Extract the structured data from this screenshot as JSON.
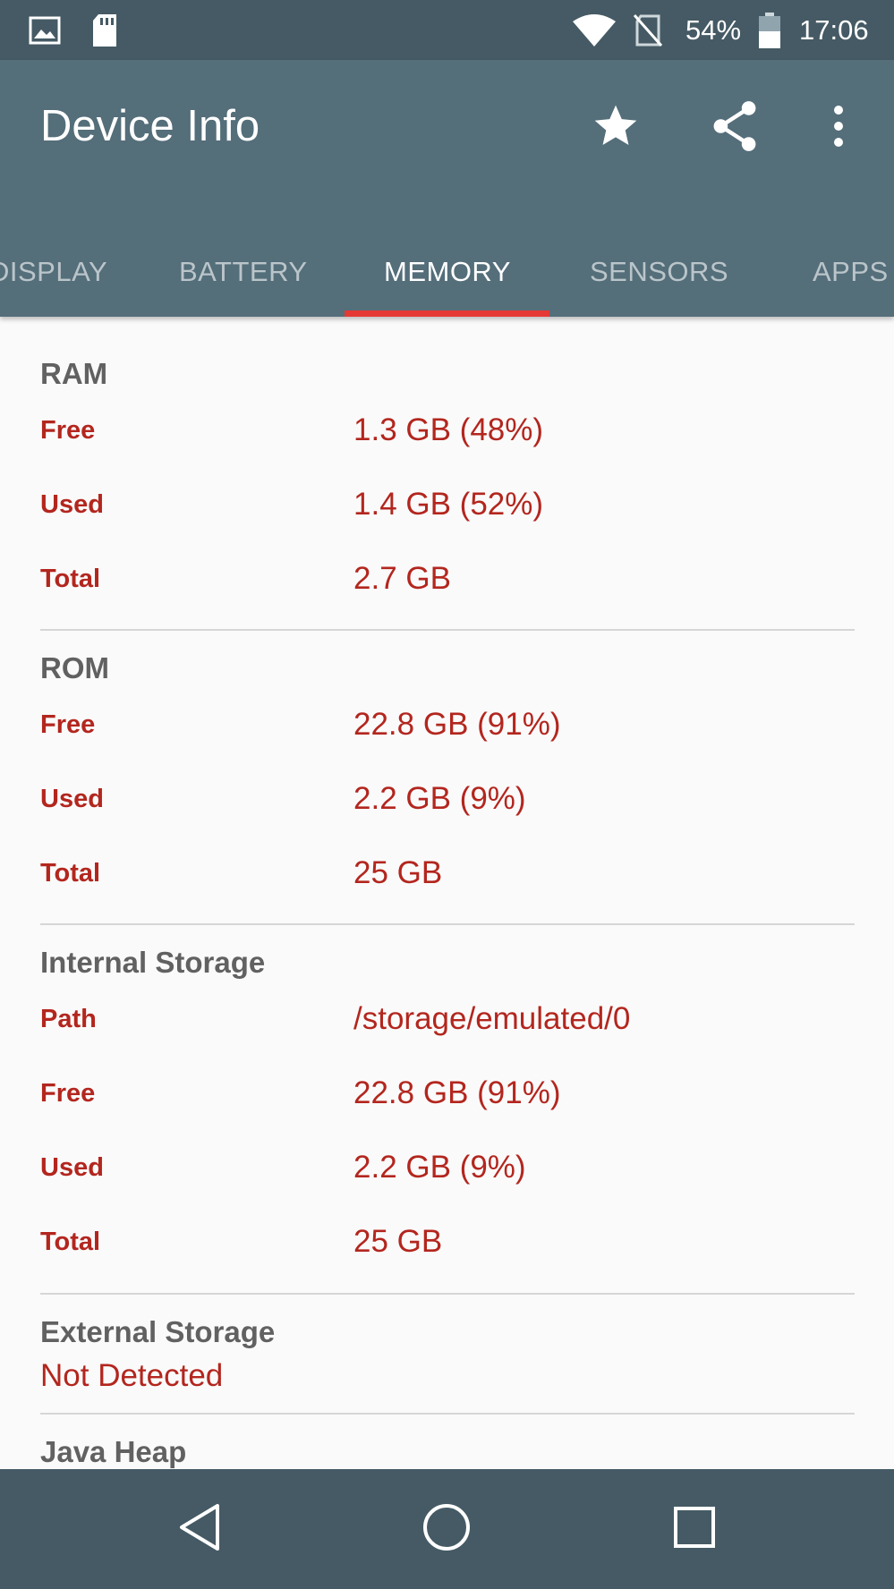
{
  "status_bar": {
    "battery": "54%",
    "time": "17:06",
    "icons": [
      "image-icon",
      "sd-card-icon",
      "wifi-icon",
      "no-sim-icon",
      "battery-icon"
    ]
  },
  "app_bar": {
    "title": "Device Info",
    "actions": [
      "star-icon",
      "share-icon",
      "more-vert-icon"
    ]
  },
  "tabs": [
    {
      "label": "DISPLAY",
      "active": false
    },
    {
      "label": "BATTERY",
      "active": false
    },
    {
      "label": "MEMORY",
      "active": true
    },
    {
      "label": "SENSORS",
      "active": false
    },
    {
      "label": "APPS",
      "active": false
    }
  ],
  "colors": {
    "status_bar": "#455a64",
    "app_bar": "#546e7a",
    "tab_indicator": "#e53935",
    "accent_text": "#b3261e",
    "section_title": "#616161"
  },
  "sections": {
    "ram": {
      "title": "RAM",
      "rows": [
        {
          "label": "Free",
          "value": "1.3 GB (48%)"
        },
        {
          "label": "Used",
          "value": "1.4 GB (52%)"
        },
        {
          "label": "Total",
          "value": "2.7 GB"
        }
      ]
    },
    "rom": {
      "title": "ROM",
      "rows": [
        {
          "label": "Free",
          "value": "22.8 GB (91%)"
        },
        {
          "label": "Used",
          "value": "2.2 GB (9%)"
        },
        {
          "label": "Total",
          "value": "25 GB"
        }
      ]
    },
    "internal": {
      "title": "Internal Storage",
      "rows": [
        {
          "label": "Path",
          "value": "/storage/emulated/0"
        },
        {
          "label": "Free",
          "value": "22.8 GB (91%)"
        },
        {
          "label": "Used",
          "value": "2.2 GB (9%)"
        },
        {
          "label": "Total",
          "value": "25 GB"
        }
      ]
    },
    "external": {
      "title": "External Storage",
      "status": "Not Detected"
    },
    "java_heap": {
      "title": "Java Heap"
    }
  },
  "nav_bar": {
    "buttons": [
      "back-icon",
      "home-icon",
      "recents-icon"
    ]
  }
}
